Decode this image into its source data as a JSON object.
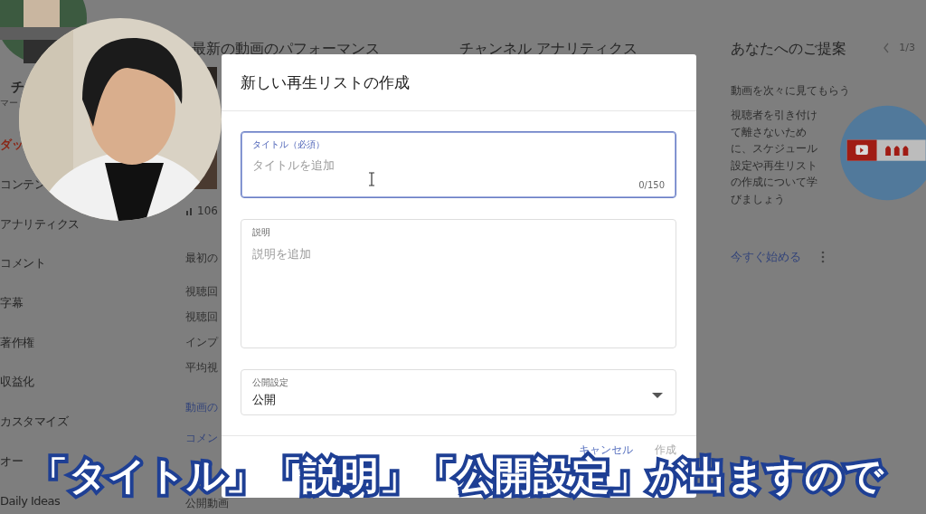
{
  "sidebar": {
    "channel_name": "チ",
    "channel_subtitle": "マー",
    "items": [
      {
        "label": "ダッ",
        "selected": true
      },
      {
        "label": "コンテン",
        "selected": false
      },
      {
        "label": "アナリティクス",
        "selected": false
      },
      {
        "label": "コメント",
        "selected": false
      },
      {
        "label": "字幕",
        "selected": false
      },
      {
        "label": "著作権",
        "selected": false
      },
      {
        "label": "収益化",
        "selected": false
      },
      {
        "label": "カスタマイズ",
        "selected": false
      },
      {
        "label": "オー",
        "selected": false
      },
      {
        "label": "Daily Ideas",
        "selected": false
      }
    ]
  },
  "performance": {
    "title": "最新の動画のパフォーマンス",
    "stat": "106",
    "section": "最初の",
    "metrics": [
      "視聴回",
      "視聴回",
      "インプ",
      "平均視"
    ],
    "links": [
      "動画の",
      "コメン"
    ],
    "footer": "公開動画"
  },
  "analytics": {
    "title": "チャンネル アナリティクス"
  },
  "suggestions": {
    "title": "あなたへのご提案",
    "pager": "1/3",
    "heading": "動画を次々に見てもらう",
    "body": "視聴者を引き付けて離さないために、スケジュール設定や再生リストの作成について学びましょう",
    "action": "今すぐ始める"
  },
  "dialog": {
    "title": "新しい再生リストの作成",
    "fields": [
      {
        "kind": "text",
        "label": "タイトル（必須）",
        "placeholder": "タイトルを追加",
        "counter": "0/150",
        "focused": true
      },
      {
        "kind": "textarea",
        "label": "説明",
        "placeholder": "説明を追加",
        "focused": false
      },
      {
        "kind": "select",
        "label": "公開設定",
        "value": "公開",
        "focused": false
      }
    ],
    "buttons": [
      {
        "label": "キャンセル",
        "disabled": false
      },
      {
        "label": "作成",
        "disabled": true
      }
    ]
  },
  "caption": "「タイトル」「説明」「公開設定」が出ますので"
}
